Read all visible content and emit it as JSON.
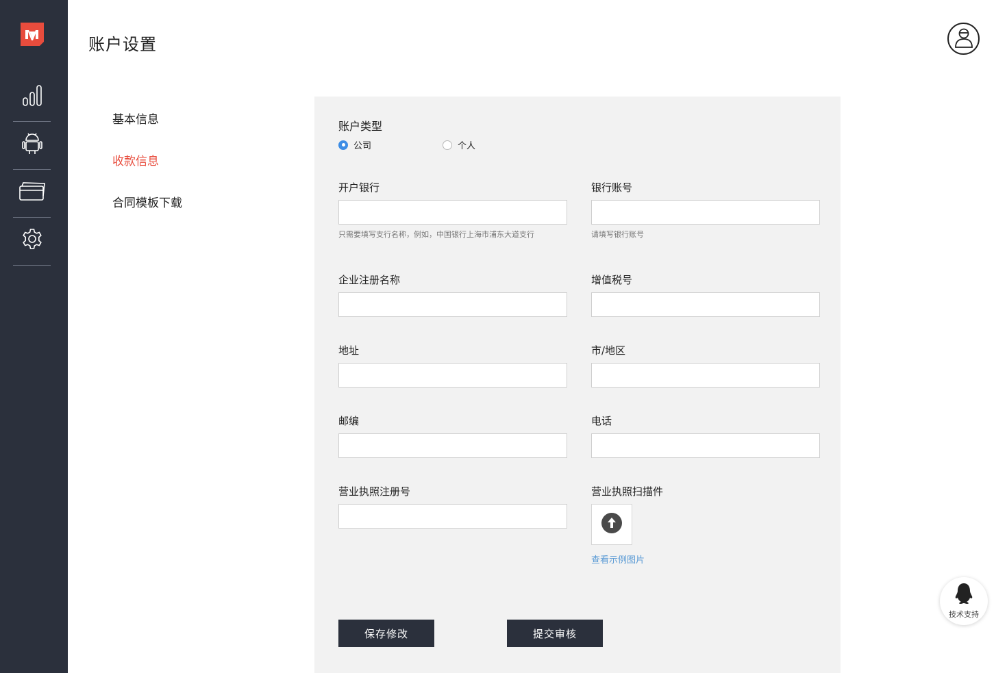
{
  "app": {
    "logo_icon": "brand-logo-icon",
    "accent_color": "#e84c3d",
    "sidebar_color": "#2b303c"
  },
  "sidebar": {
    "items": [
      {
        "icon": "bar-chart-icon"
      },
      {
        "icon": "android-icon"
      },
      {
        "icon": "credit-card-icon"
      },
      {
        "icon": "gear-icon"
      }
    ]
  },
  "header": {
    "title": "账户设置",
    "avatar_icon": "user-avatar-icon"
  },
  "subnav": {
    "items": [
      {
        "label": "基本信息",
        "active": false
      },
      {
        "label": "收款信息",
        "active": true
      },
      {
        "label": "合同模板下载",
        "active": false
      }
    ]
  },
  "form": {
    "account_type": {
      "label": "账户类型",
      "options": [
        {
          "label": "公司",
          "selected": true
        },
        {
          "label": "个人",
          "selected": false
        }
      ]
    },
    "bank": {
      "label": "开户银行",
      "value": "",
      "hint": "只需要填写支行名称，例如，中国银行上海市浦东大道支行"
    },
    "account_no": {
      "label": "银行账号",
      "value": "",
      "hint": "请填写银行账号"
    },
    "company_name": {
      "label": "企业注册名称",
      "value": ""
    },
    "tax_no": {
      "label": "增值税号",
      "value": ""
    },
    "address": {
      "label": "地址",
      "value": ""
    },
    "city": {
      "label": "市/地区",
      "value": ""
    },
    "postcode": {
      "label": "邮编",
      "value": ""
    },
    "phone": {
      "label": "电话",
      "value": ""
    },
    "license_no": {
      "label": "营业执照注册号",
      "value": ""
    },
    "license_scan": {
      "label": "营业执照扫描件",
      "upload_icon": "upload-arrow-icon",
      "example_link": "查看示例图片"
    },
    "save_button": "保存修改",
    "submit_button": "提交审核"
  },
  "support": {
    "label": "技术支持",
    "icon": "qq-penguin-icon"
  }
}
